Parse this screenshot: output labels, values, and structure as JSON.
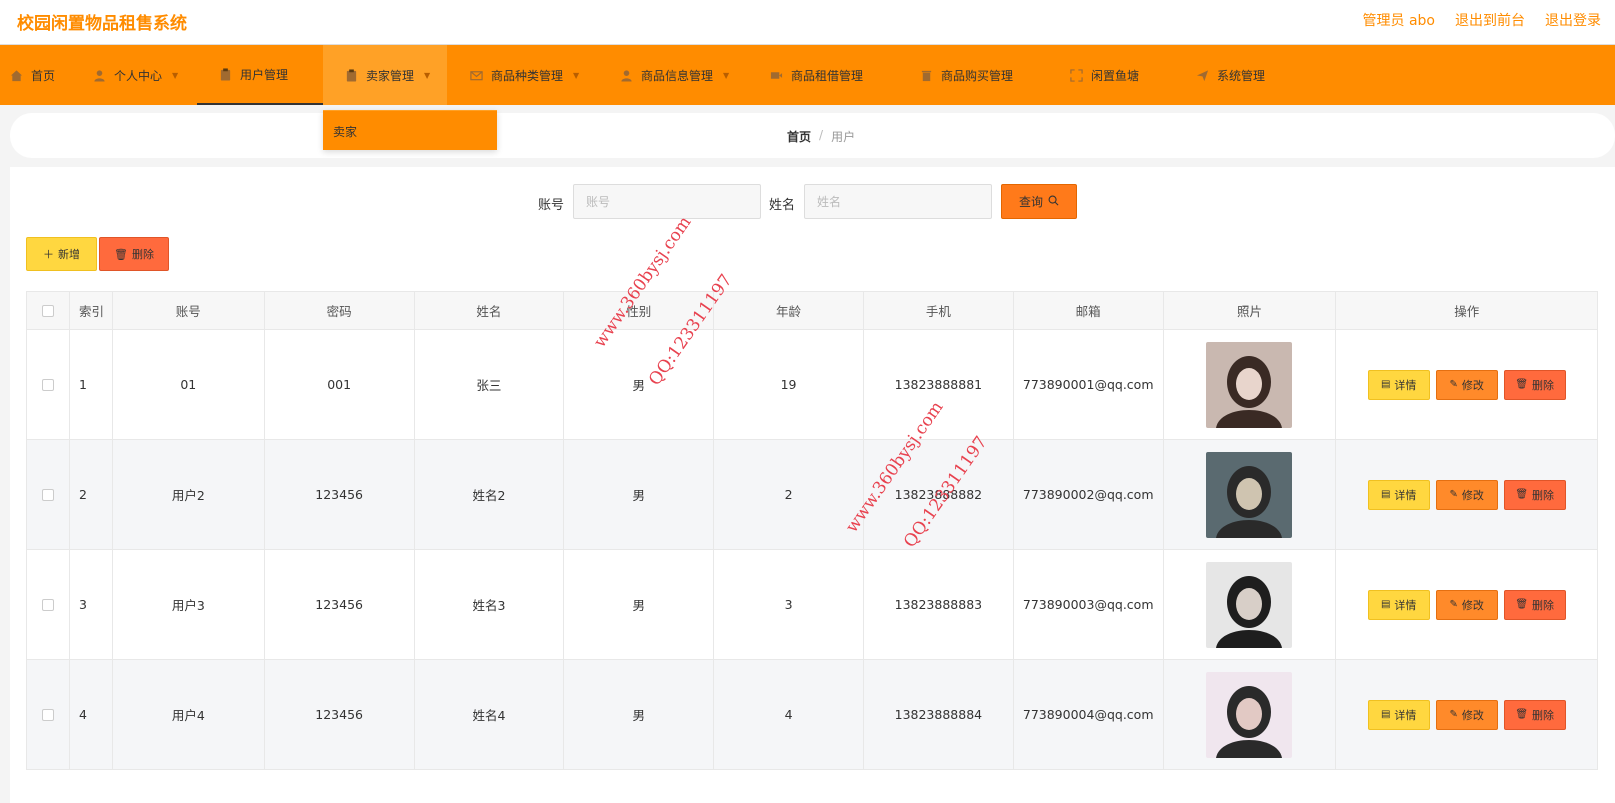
{
  "app": {
    "title": "校园闲置物品租售系统"
  },
  "top_links": {
    "admin": "管理员 abo",
    "to_front": "退出到前台",
    "logout": "退出登录"
  },
  "nav": {
    "home": "首页",
    "personal": "个人中心",
    "users": "用户管理",
    "sellers": "卖家管理",
    "categories": "商品种类管理",
    "goods_info": "商品信息管理",
    "goods_rent": "商品租借管理",
    "goods_buy": "商品购买管理",
    "fish_pond": "闲置鱼塘",
    "system": "系统管理"
  },
  "dropdown": {
    "seller": "卖家"
  },
  "breadcrumb": {
    "home": "首页",
    "separator": "/",
    "current": "用户"
  },
  "search": {
    "account_label": "账号",
    "account_placeholder": "账号",
    "account_value": "",
    "name_label": "姓名",
    "name_placeholder": "姓名",
    "name_value": "",
    "query_label": "查询"
  },
  "toolbar": {
    "add_label": "新增",
    "delete_label": "删除"
  },
  "table": {
    "headers": {
      "index": "索引",
      "account": "账号",
      "password": "密码",
      "name": "姓名",
      "sex": "性别",
      "age": "年龄",
      "phone": "手机",
      "email": "邮箱",
      "photo": "照片",
      "actions": "操作"
    },
    "row_actions": {
      "detail": "详情",
      "edit": "修改",
      "delete": "删除"
    },
    "rows": [
      {
        "index": "1",
        "account": "01",
        "password": "001",
        "name": "张三",
        "sex": "男",
        "age": "19",
        "phone": "13823888881",
        "email": "773890001@qq.com"
      },
      {
        "index": "2",
        "account": "用户2",
        "password": "123456",
        "name": "姓名2",
        "sex": "男",
        "age": "2",
        "phone": "13823888882",
        "email": "773890002@qq.com"
      },
      {
        "index": "3",
        "account": "用户3",
        "password": "123456",
        "name": "姓名3",
        "sex": "男",
        "age": "3",
        "phone": "13823888883",
        "email": "773890003@qq.com"
      },
      {
        "index": "4",
        "account": "用户4",
        "password": "123456",
        "name": "姓名4",
        "sex": "男",
        "age": "4",
        "phone": "13823888884",
        "email": "773890004@qq.com"
      }
    ]
  },
  "watermark": {
    "site": "www.360bysj.com",
    "qq": "QQ:123311197"
  },
  "colors": {
    "accent": "#ff8c00",
    "yellow_button": "#ffd740",
    "orange_button": "#ff8a2a",
    "red_button": "#ff6a3d",
    "watermark": "#e8424f"
  }
}
